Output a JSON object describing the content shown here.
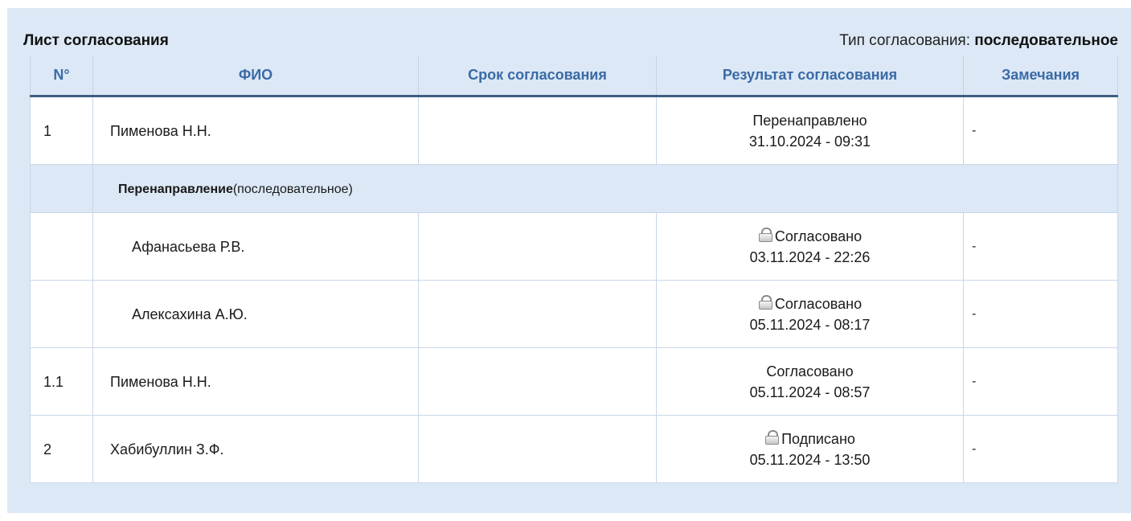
{
  "header": {
    "title": "Лист согласования",
    "type_prefix": "Тип согласования: ",
    "type_value": "последовательное"
  },
  "table": {
    "columns": [
      "N°",
      "ФИО",
      "Срок согласования",
      "Результат согласования",
      "Замечания"
    ],
    "rows": [
      {
        "num": "1",
        "name": "Пименова Н.Н.",
        "deadline": "",
        "result": "Перенаправлено",
        "date": "31.10.2024 - 09:31",
        "notes": "-",
        "locked": false
      },
      {
        "sub_bold": "Перенаправление",
        "sub_rest": "(последовательное)"
      },
      {
        "num": "",
        "name": "Афанасьева Р.В.",
        "deadline": "",
        "result": "Согласовано",
        "date": "03.11.2024 - 22:26",
        "notes": "-",
        "locked": true
      },
      {
        "num": "",
        "name": "Алексахина А.Ю.",
        "deadline": "",
        "result": "Согласовано",
        "date": "05.11.2024 - 08:17",
        "notes": "-",
        "locked": true
      },
      {
        "num": "1.1",
        "name": "Пименова Н.Н.",
        "deadline": "",
        "result": "Согласовано",
        "date": "05.11.2024 - 08:57",
        "notes": "-",
        "locked": false
      },
      {
        "num": "2",
        "name": "Хабибуллин З.Ф.",
        "deadline": "",
        "result": "Подписано",
        "date": "05.11.2024 - 13:50",
        "notes": "-",
        "locked": true
      }
    ]
  },
  "icons": {
    "lock": "lock-icon"
  }
}
